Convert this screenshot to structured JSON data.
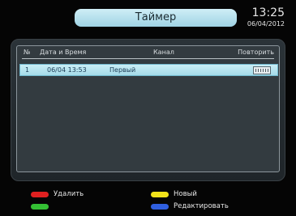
{
  "header": {
    "title": "Таймер",
    "time": "13:25",
    "date": "06/04/2012"
  },
  "table": {
    "columns": [
      "№",
      "Дата и Время",
      "Канал",
      "Повторить"
    ],
    "rows": [
      {
        "num": "1",
        "datetime": "06/04 13:53",
        "channel": "Первый",
        "repeat_icon": "calendar-grid-icon"
      }
    ]
  },
  "footer": {
    "red": "Удалить",
    "green": "",
    "yellow": "Новый",
    "blue": "Редактировать"
  },
  "colors": {
    "accent": "#a5dbe9",
    "red_key": "#e02020",
    "green_key": "#34c034",
    "yellow_key": "#f2e21a",
    "blue_key": "#2f5fe0"
  }
}
